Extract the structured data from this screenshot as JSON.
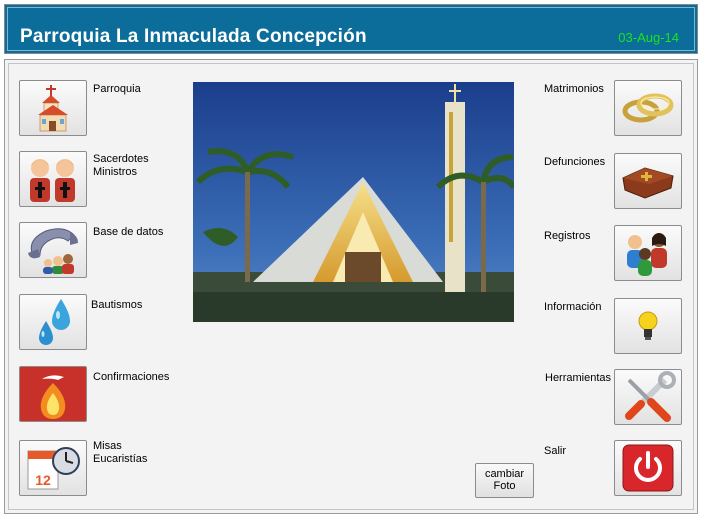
{
  "header": {
    "title": "Parroquia La Inmaculada Concepción",
    "date": "03-Aug-14"
  },
  "left_menu": [
    {
      "label": "Parroquia",
      "icon": "church-icon"
    },
    {
      "label": "Sacerdotes\nMinistros",
      "icon": "priests-icon"
    },
    {
      "label": "Base de datos",
      "icon": "phone-contacts-icon"
    },
    {
      "label": "Bautismos",
      "icon": "water-drops-icon"
    },
    {
      "label": "Confirmaciones",
      "icon": "holy-spirit-flame-icon"
    },
    {
      "label": "Misas\nEucaristías",
      "icon": "calendar-clock-icon"
    }
  ],
  "right_menu": [
    {
      "label": "Matrimonios",
      "icon": "wedding-rings-icon"
    },
    {
      "label": "Defunciones",
      "icon": "coffin-icon"
    },
    {
      "label": "Registros",
      "icon": "people-icon"
    },
    {
      "label": "Información",
      "icon": "lightbulb-icon"
    },
    {
      "label": "Herramientas",
      "icon": "tools-icon"
    },
    {
      "label": "Salir",
      "icon": "power-icon"
    }
  ],
  "photo_button": {
    "label": "cambiar\nFoto"
  },
  "colors": {
    "header_bg": "#0d6d9a",
    "date": "#16e51c",
    "exit_red": "#d8262a"
  }
}
